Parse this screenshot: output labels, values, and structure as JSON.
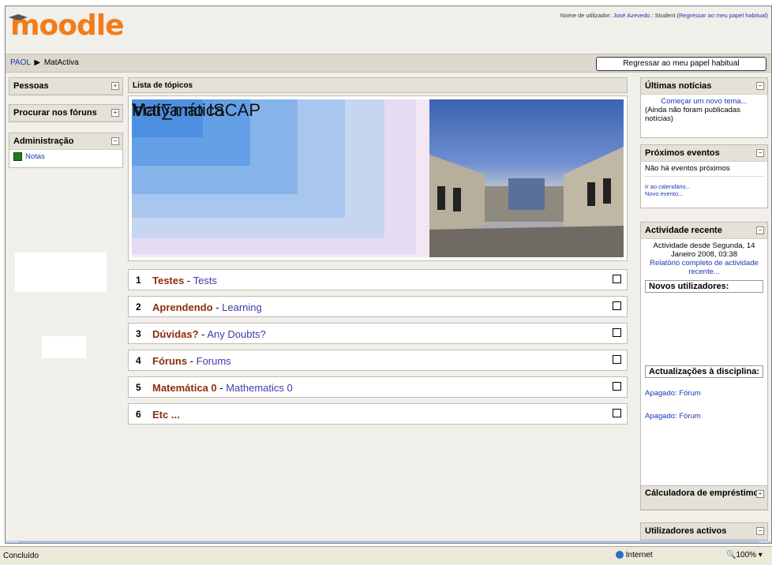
{
  "header": {
    "logo_text": "moodle",
    "user_prefix": "Nome de utilizador: ",
    "user_name": "José Azevedo",
    "user_role": ".: Student (",
    "return_role_link": "Regressar ao meu papel habitual",
    "user_suffix": ")"
  },
  "navbar": {
    "breadcrumb": [
      "PAOL",
      "MatActiva"
    ],
    "separator": "▶",
    "return_button": "Regressar ao meu papel habitual"
  },
  "left_blocks": {
    "people": {
      "title": "Pessoas",
      "toggle": "+"
    },
    "forum_search": {
      "title": "Procurar nos fóruns",
      "toggle": "+"
    },
    "admin": {
      "title": "Administração",
      "toggle": "−",
      "items": [
        "Notas"
      ]
    }
  },
  "center": {
    "header": "Lista de tópicos",
    "banner_line1": "Mat∑mática",
    "banner_line2": "∀ctiva no ISCAP",
    "topics": [
      {
        "num": "1",
        "pt": "Testes",
        "sep": " - ",
        "en": "Tests"
      },
      {
        "num": "2",
        "pt": "Aprendendo",
        "sep": " - ",
        "en": "Learning"
      },
      {
        "num": "3",
        "pt": "Dúvidas?",
        "sep": " - ",
        "en": "Any Doubts?"
      },
      {
        "num": "4",
        "pt": "Fóruns",
        "sep": " - ",
        "en": "Forums"
      },
      {
        "num": "5",
        "pt": "Matemática 0",
        "sep": " - ",
        "en": "Mathematics 0"
      },
      {
        "num": "6",
        "pt": "Etc ...",
        "sep": "",
        "en": ""
      }
    ]
  },
  "right_blocks": {
    "news": {
      "title": "Últimas notícias",
      "toggle": "−",
      "link": "Começar um novo tema...",
      "text": "(Ainda não foram publicadas notícias)"
    },
    "events": {
      "title": "Próximos eventos",
      "toggle": "−",
      "text": "Não há eventos próximos",
      "link1": "Ir ao calendário...",
      "link2": "Novo evento..."
    },
    "recent": {
      "title": "Actividade recente",
      "toggle": "−",
      "text": "Actividade desde Segunda, 14 Janeiro 2008, 03:38",
      "link": "Relatório completo de actividade recente..."
    },
    "new_users": {
      "title": "Novos utilizadores:"
    },
    "updates": {
      "title": "Actualizações à disciplina:",
      "items": [
        "Apagado: Fórum",
        "Apagado: Fórum"
      ]
    },
    "loan": {
      "title": "Cálculadora de empréstimos",
      "toggle": "+"
    },
    "active": {
      "title": "Utilizadores activos",
      "toggle": "−"
    }
  },
  "statusbar": {
    "status": "Concluído",
    "zone": "Internet",
    "zoom": "100%"
  }
}
